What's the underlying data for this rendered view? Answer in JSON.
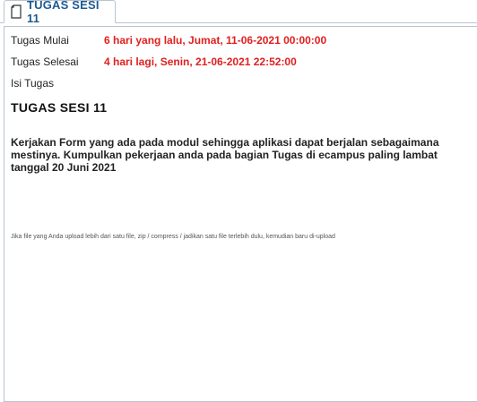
{
  "tab": {
    "label": "TUGAS SESI 11",
    "icon": "document-icon"
  },
  "schedule": {
    "start_label": "Tugas Mulai",
    "start_value": "6 hari yang lalu, Jumat, 11-06-2021 00:00:00",
    "end_label": "Tugas Selesai",
    "end_value": "4 hari lagi, Senin, 21-06-2021 22:52:00"
  },
  "content": {
    "section_label": "Isi Tugas",
    "title": "TUGAS SESI 11",
    "description": "Kerjakan Form yang ada pada modul sehingga aplikasi dapat berjalan sebagaimana mestinya. Kumpulkan pekerjaan anda pada bagian Tugas di ecampus paling lambat tanggal 20 Juni 2021",
    "upload_note": "Jika file yang Anda upload lebih dari satu file, zip / compress / jadikan satu file terlebih dulu, kemudian baru di-upload"
  },
  "colors": {
    "tab_text": "#1c5a93",
    "date_value": "#e01f1f",
    "border": "#b9c4cf"
  }
}
